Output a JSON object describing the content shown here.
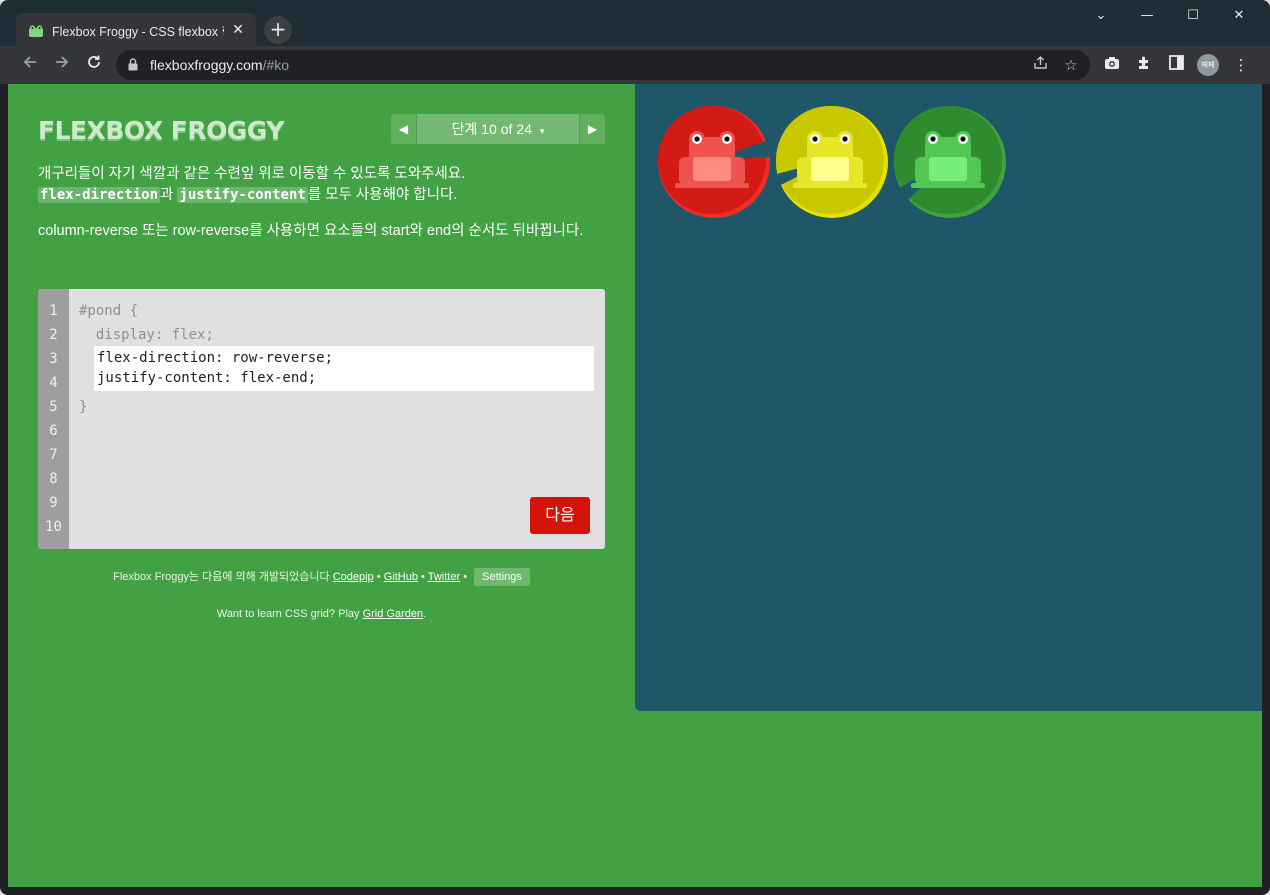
{
  "browser": {
    "tab_title": "Flexbox Froggy - CSS flexbox 학",
    "tab_close": "✕",
    "new_tab": "+",
    "url_host": "flexboxfroggy.com",
    "url_path": "/#ko",
    "profile_initials": "페페",
    "window_controls": {
      "collapse": "⌄",
      "minimize": "—",
      "maximize": "☐",
      "close": "✕"
    }
  },
  "game": {
    "logo": "FLEXBOX FROGGY",
    "level": {
      "prev": "◀",
      "next": "▶",
      "label": "단계 10 of 24",
      "caret": "▾"
    },
    "instructions": {
      "p1_text": "개구리들이 자기 색깔과 같은 수련잎 위로 이동할 수 있도록 도와주세요.",
      "p1_code1": "flex-direction",
      "p1_mid": "과",
      "p1_code2": "justify-content",
      "p1_end": "를 모두 사용해야 합니다.",
      "p2": "column-reverse 또는 row-reverse를 사용하면 요소들의 start와 end의 순서도 뒤바뀝니다."
    },
    "editor": {
      "line_numbers": [
        "1",
        "2",
        "3",
        "4",
        "5",
        "6",
        "7",
        "8",
        "9",
        "10"
      ],
      "line1": "#pond {",
      "line2": "  display: flex;",
      "input_line1": "flex-direction: row-reverse;",
      "input_line2": "justify-content: flex-end;",
      "line_close": "}",
      "next_label": "다음"
    },
    "credits": {
      "prefix": "Flexbox Froggy는 다음에 의해 개발되었습니다",
      "codepip": "Codepip",
      "sep": "•",
      "github": "GitHub",
      "twitter": "Twitter",
      "settings": "Settings"
    },
    "promo": {
      "prefix": "Want to learn CSS grid? Play",
      "link": "Grid Garden",
      "suffix": "."
    },
    "frogs": [
      {
        "color": "red",
        "pad": "#d31a14",
        "pad_dark": "#ee2d27",
        "body": "#ef5350",
        "belly": "#ff8a80"
      },
      {
        "color": "yellow",
        "pad": "#c9c700",
        "pad_dark": "#e3e100",
        "body": "#e8e62a",
        "belly": "#ffff8d"
      },
      {
        "color": "green",
        "pad": "#2e8b2e",
        "pad_dark": "#3fa33f",
        "body": "#52c852",
        "belly": "#77ee77"
      }
    ]
  }
}
